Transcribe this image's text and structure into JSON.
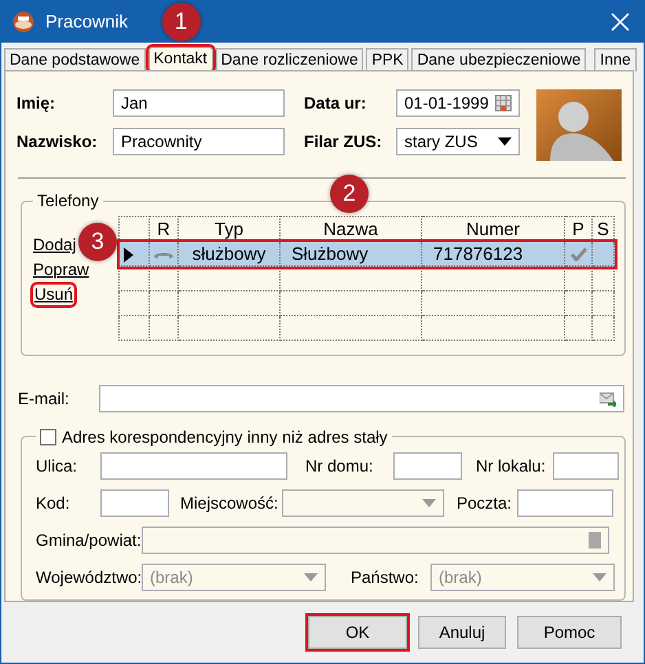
{
  "window": {
    "title": "Pracownik"
  },
  "tabs": [
    {
      "label": "Dane podstawowe",
      "selected": false,
      "highlighted": false
    },
    {
      "label": "Kontakt",
      "selected": true,
      "highlighted": true,
      "callout": "1"
    },
    {
      "label": "Dane rozliczeniowe",
      "selected": false,
      "highlighted": false
    },
    {
      "label": "PPK",
      "selected": false,
      "highlighted": false
    },
    {
      "label": "Dane ubezpieczeniowe",
      "selected": false,
      "highlighted": false
    },
    {
      "label": "Inne",
      "selected": false,
      "highlighted": false
    }
  ],
  "personal": {
    "first_name": {
      "label": "Imię:",
      "value": "Jan"
    },
    "last_name": {
      "label": "Nazwisko:",
      "value": "Pracownity"
    },
    "birth_date": {
      "label": "Data ur:",
      "value": "01-01-1999"
    },
    "zus_pillar": {
      "label": "Filar ZUS:",
      "value": "stary ZUS"
    }
  },
  "phones": {
    "title": "Telefony",
    "actions": [
      {
        "label": "Dodaj",
        "highlighted": false,
        "callout": "3"
      },
      {
        "label": "Popraw",
        "highlighted": false
      },
      {
        "label": "Usuń",
        "highlighted": true
      }
    ],
    "columns": [
      "R",
      "Typ",
      "Nazwa",
      "Numer",
      "P",
      "S"
    ],
    "rows": [
      {
        "selected": true,
        "highlighted": true,
        "callout": "2",
        "type": "służbowy",
        "name": "Służbowy",
        "number": "717876123",
        "primary": true
      }
    ]
  },
  "email": {
    "label": "E-mail:"
  },
  "address": {
    "checkbox": {
      "label": "Adres korespondencyjny inny niż adres stały",
      "checked": false
    },
    "rows": [
      [
        {
          "label": "Ulica:",
          "kind": "text"
        },
        {
          "label": "Nr domu:",
          "kind": "text"
        },
        {
          "label": "Nr lokalu:",
          "kind": "text"
        }
      ],
      [
        {
          "label": "Kod:",
          "kind": "text"
        },
        {
          "label": "Miejscowość:",
          "kind": "select"
        },
        {
          "label": "Poczta:",
          "kind": "text"
        }
      ],
      [
        {
          "label": "Gmina/powiat:",
          "kind": "lookup"
        }
      ],
      [
        {
          "label": "Województwo:",
          "kind": "select",
          "value": "(brak)"
        },
        {
          "label": "Państwo:",
          "kind": "select",
          "value": "(brak)"
        }
      ]
    ]
  },
  "buttons": [
    {
      "label": "OK",
      "highlighted": true
    },
    {
      "label": "Anuluj",
      "highlighted": false
    },
    {
      "label": "Pomoc",
      "highlighted": false
    }
  ]
}
